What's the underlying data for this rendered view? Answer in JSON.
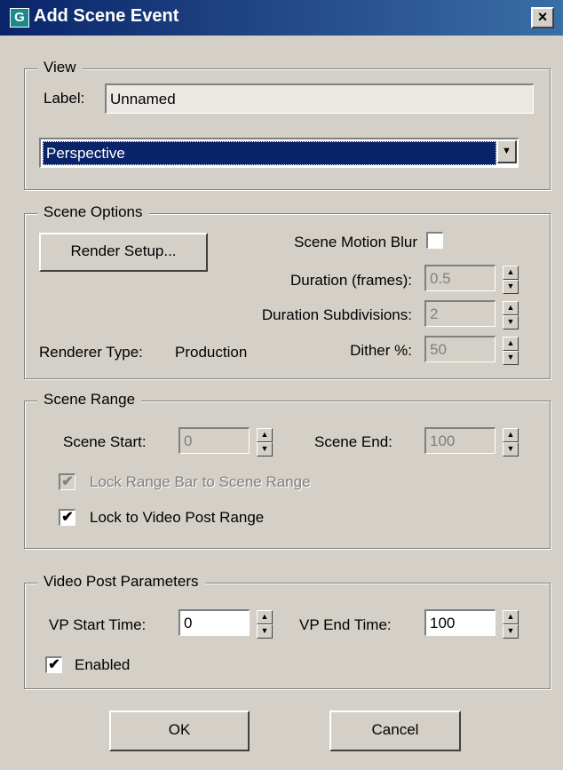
{
  "window": {
    "title": "Add Scene Event",
    "app_icon": "G",
    "close_glyph": "×"
  },
  "view": {
    "legend": "View",
    "label_caption": "Label:",
    "label_value": "Unnamed",
    "viewport_selected": "Perspective"
  },
  "scene_options": {
    "legend": "Scene Options",
    "render_setup": "Render Setup...",
    "motion_blur_label": "Scene Motion Blur",
    "motion_blur_checked": false,
    "duration_label": "Duration (frames):",
    "duration_value": "0.5",
    "subdivisions_label": "Duration Subdivisions:",
    "subdivisions_value": "2",
    "renderer_type_label": "Renderer Type:",
    "renderer_type_value": "Production",
    "dither_label": "Dither %:",
    "dither_value": "50"
  },
  "scene_range": {
    "legend": "Scene Range",
    "start_label": "Scene Start:",
    "start_value": "0",
    "end_label": "Scene End:",
    "end_value": "100",
    "lock_range_bar_label": "Lock Range Bar to Scene Range",
    "lock_range_bar_checked": true,
    "lock_video_post_label": "Lock to Video Post Range",
    "lock_video_post_checked": true
  },
  "video_post": {
    "legend": "Video Post Parameters",
    "vp_start_label": "VP Start Time:",
    "vp_start_value": "0",
    "vp_end_label": "VP End Time:",
    "vp_end_value": "100",
    "enabled_label": "Enabled",
    "enabled_checked": true
  },
  "buttons": {
    "ok": "OK",
    "cancel": "Cancel"
  },
  "glyphs": {
    "check": "✔",
    "spin_up": "▲",
    "spin_down": "▼",
    "dropdown_arrow": "▼"
  }
}
